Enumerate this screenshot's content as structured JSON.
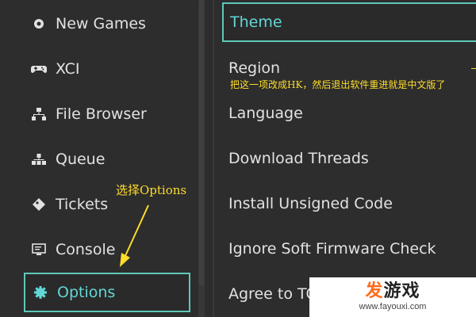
{
  "sidebar": {
    "items": [
      {
        "label": "New Games",
        "icon": "new-games-icon"
      },
      {
        "label": "XCI",
        "icon": "gamepad-icon"
      },
      {
        "label": "File Browser",
        "icon": "file-tree-icon"
      },
      {
        "label": "Queue",
        "icon": "queue-icon"
      },
      {
        "label": "Tickets",
        "icon": "ticket-icon"
      },
      {
        "label": "Console",
        "icon": "console-icon"
      },
      {
        "label": "Options",
        "icon": "gear-icon",
        "selected": true
      }
    ]
  },
  "options": {
    "items": [
      {
        "label": "Theme",
        "selected": true
      },
      {
        "label": "Region"
      },
      {
        "label": "Language"
      },
      {
        "label": "Download Threads"
      },
      {
        "label": "Install Unsigned Code"
      },
      {
        "label": "Ignore Soft Firmware Check"
      },
      {
        "label": "Agree to TC"
      }
    ]
  },
  "annotations": {
    "region_note": "把这一项改成HK，然后退出软件重进就是中文版了",
    "options_note": "选择Options"
  },
  "watermark": {
    "title_hot": "发",
    "title_rest": "游戏",
    "site": "www.fayouxi.com"
  },
  "colors": {
    "accent": "#63d6d6",
    "annotation": "#ffdd2a",
    "background": "#2d2d2d"
  }
}
